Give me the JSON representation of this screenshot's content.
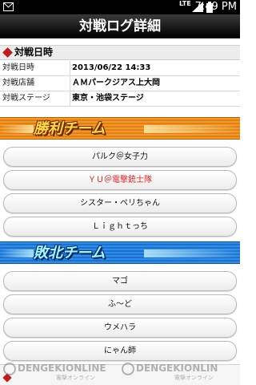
{
  "status_bar": {
    "network": "LTE",
    "time": "7:49 PM"
  },
  "page_title": "対戦ログ詳細",
  "battle_info": {
    "section_title": "対戦日時",
    "rows": [
      {
        "label": "対戦日時",
        "value": "2013/06/22 14:33"
      },
      {
        "label": "対戦店舗",
        "value": "ＡＭパークジアス上大岡"
      },
      {
        "label": "対戦ステージ",
        "value": "東京・池袋ステージ"
      }
    ]
  },
  "win_team": {
    "banner": "勝利チーム",
    "players": [
      {
        "name": "パルク＠女子力"
      },
      {
        "name": "ＹＵ＠電撃銃士隊"
      },
      {
        "name": "シスター・ペリちゃん"
      },
      {
        "name": "Ｌｉｇｈｔっち"
      }
    ]
  },
  "lose_team": {
    "banner": "敗北チーム",
    "players": [
      {
        "name": "マゴ"
      },
      {
        "name": "ふ～ど"
      },
      {
        "name": "ウメハラ"
      },
      {
        "name": "にゃん師"
      }
    ]
  },
  "watermark": {
    "text1": "DENGEKIONLINE",
    "text2": "DENGEKIONLIN",
    "sub1": "電撃オンライン",
    "sub2": "電撃オンライン"
  },
  "colors": {
    "win_banner": "#e57e12",
    "lose_banner": "#1c70cf",
    "highlight_player": "#e0201b",
    "section_marker": "#c21b1b"
  }
}
